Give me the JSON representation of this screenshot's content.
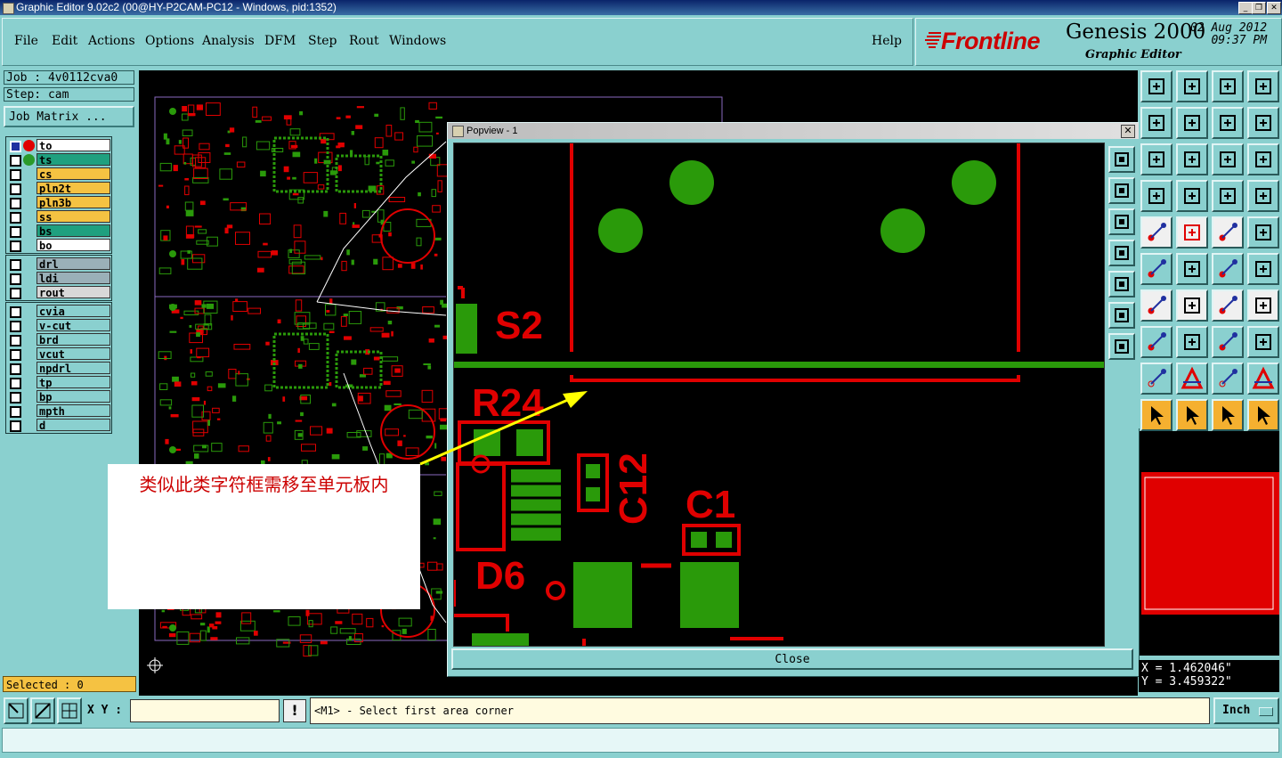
{
  "window": {
    "title": "Graphic Editor 9.02c2 (00@HY-P2CAM-PC12 - Windows, pid:1352)",
    "min_label": "_",
    "max_label": "❐",
    "close_label": "✕"
  },
  "menu": {
    "file": "File",
    "edit": "Edit",
    "actions": "Actions",
    "options": "Options",
    "analysis": "Analysis",
    "dfm": "DFM",
    "step": "Step",
    "rout": "Rout",
    "windows": "Windows",
    "help": "Help"
  },
  "brand": {
    "logo": "Frontline",
    "product": "Genesis 2000",
    "subtitle": "Graphic Editor",
    "date": "02 Aug 2012",
    "time": "09:37 PM"
  },
  "job": {
    "job_label": "Job : 4v0112cva0",
    "step_label": "Step: cam",
    "matrix_button": "Job Matrix ..."
  },
  "layers": {
    "board": [
      {
        "name": "to",
        "color": "#ffffff",
        "dot": "#e00000"
      },
      {
        "name": "ts",
        "color": "#1fa07f",
        "dot": "#2a9a2a"
      },
      {
        "name": "cs",
        "color": "#f5c242",
        "dot": ""
      },
      {
        "name": "pln2t",
        "color": "#f5c242",
        "dot": ""
      },
      {
        "name": "pln3b",
        "color": "#f5c242",
        "dot": ""
      },
      {
        "name": "ss",
        "color": "#f5c242",
        "dot": ""
      },
      {
        "name": "bs",
        "color": "#1fa07f",
        "dot": ""
      },
      {
        "name": "bo",
        "color": "#ffffff",
        "dot": ""
      }
    ],
    "drill": [
      {
        "name": "drl",
        "color": "#9ab0b8"
      },
      {
        "name": "ldi",
        "color": "#9ab0b8"
      },
      {
        "name": "rout",
        "color": "#d8d8d8"
      }
    ],
    "misc": [
      {
        "name": "cvia",
        "color": "#8ad0cf"
      },
      {
        "name": "v-cut",
        "color": "#8ad0cf"
      },
      {
        "name": "brd",
        "color": "#8ad0cf"
      },
      {
        "name": "vcut",
        "color": "#8ad0cf"
      },
      {
        "name": "npdrl",
        "color": "#8ad0cf"
      },
      {
        "name": "tp",
        "color": "#8ad0cf"
      },
      {
        "name": "bp",
        "color": "#8ad0cf"
      },
      {
        "name": "mpth",
        "color": "#8ad0cf"
      },
      {
        "name": "d",
        "color": "#8ad0cf"
      }
    ]
  },
  "selected": "Selected : 0",
  "popview": {
    "title": "Popview - 1",
    "close_button": "Close",
    "refdes": {
      "s2": "S2",
      "r24": "R24",
      "c12": "C12",
      "c1": "C1",
      "d6": "D6"
    }
  },
  "annotation": {
    "text": "类似此类字符框需移至单元板内"
  },
  "coords": {
    "x": "X = 1.462046\"",
    "y": "Y = 3.459322\""
  },
  "bottom": {
    "xy_label": "X Y :",
    "xy_value": "",
    "warn": "!",
    "status": "<M1> - Select first area corner",
    "units": "Inch"
  },
  "colors": {
    "panel": "#8ad0cf",
    "copper": "#2a9a0a",
    "silk": "#e00000",
    "annotation_arrow": "#ffff00"
  }
}
